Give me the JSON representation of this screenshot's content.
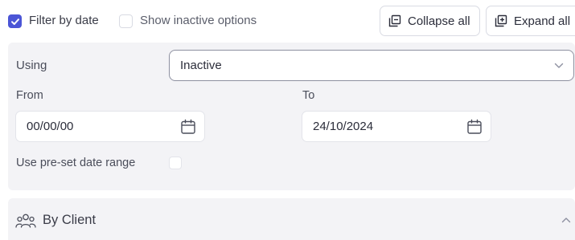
{
  "toolbar": {
    "filter_by_date": {
      "label": "Filter by date",
      "checked": true
    },
    "show_inactive": {
      "label": "Show inactive options",
      "checked": false
    },
    "collapse_all_label": "Collapse all",
    "expand_all_label": "Expand all"
  },
  "filter": {
    "using_label": "Using",
    "using_value": "Inactive",
    "from_label": "From",
    "from_value": "00/00/00",
    "to_label": "To",
    "to_value": "24/10/2024",
    "preset_label": "Use pre-set date range",
    "preset_checked": false
  },
  "group": {
    "title": "By Client",
    "icon": "users-icon",
    "expanded": true
  },
  "colors": {
    "accent": "#4b55d6",
    "panel_bg": "#f3f3f6",
    "border": "#d9dbe3"
  }
}
